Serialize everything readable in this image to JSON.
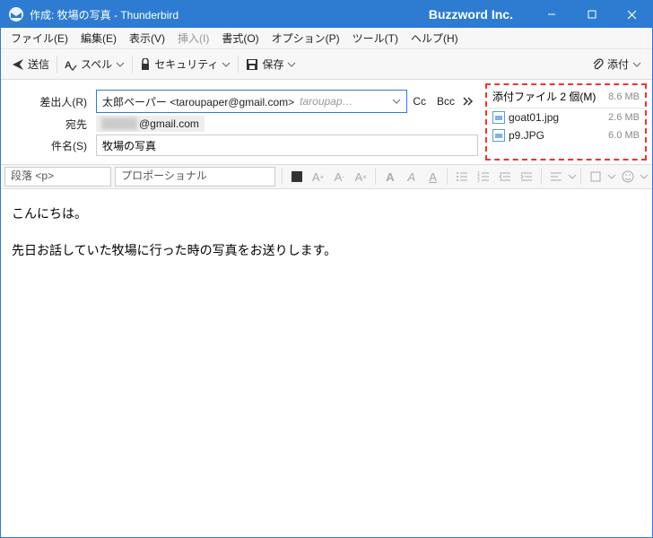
{
  "window": {
    "title": "作成: 牧場の写真 - Thunderbird",
    "brand": "Buzzword Inc."
  },
  "menu": {
    "file": "ファイル(E)",
    "edit": "編集(E)",
    "view": "表示(V)",
    "insert": "挿入(I)",
    "format": "書式(O)",
    "options": "オプション(P)",
    "tools": "ツール(T)",
    "help": "ヘルプ(H)"
  },
  "toolbar": {
    "send": "送信",
    "spell": "スペル",
    "security": "セキュリティ",
    "save": "保存",
    "attach": "添付"
  },
  "headers": {
    "from_label": "差出人(R)",
    "from_value": "太郎ペーパー <taroupaper@gmail.com>",
    "from_extra": "taroupap…",
    "cc": "Cc",
    "bcc": "Bcc",
    "to_label": "宛先",
    "to_value": "@gmail.com",
    "subject_label": "件名(S)",
    "subject_value": "牧場の写真"
  },
  "attachments": {
    "header": "添付ファイル 2 個(M)",
    "total_size": "8.6 MB",
    "items": [
      {
        "name": "goat01.jpg",
        "size": "2.6 MB"
      },
      {
        "name": "p9.JPG",
        "size": "6.0 MB"
      }
    ]
  },
  "format": {
    "para": "段落 <p>",
    "font": "プロポーショナル"
  },
  "body": {
    "line1": "こんにちは。",
    "line2": "先日お話していた牧場に行った時の写真をお送りします。"
  }
}
